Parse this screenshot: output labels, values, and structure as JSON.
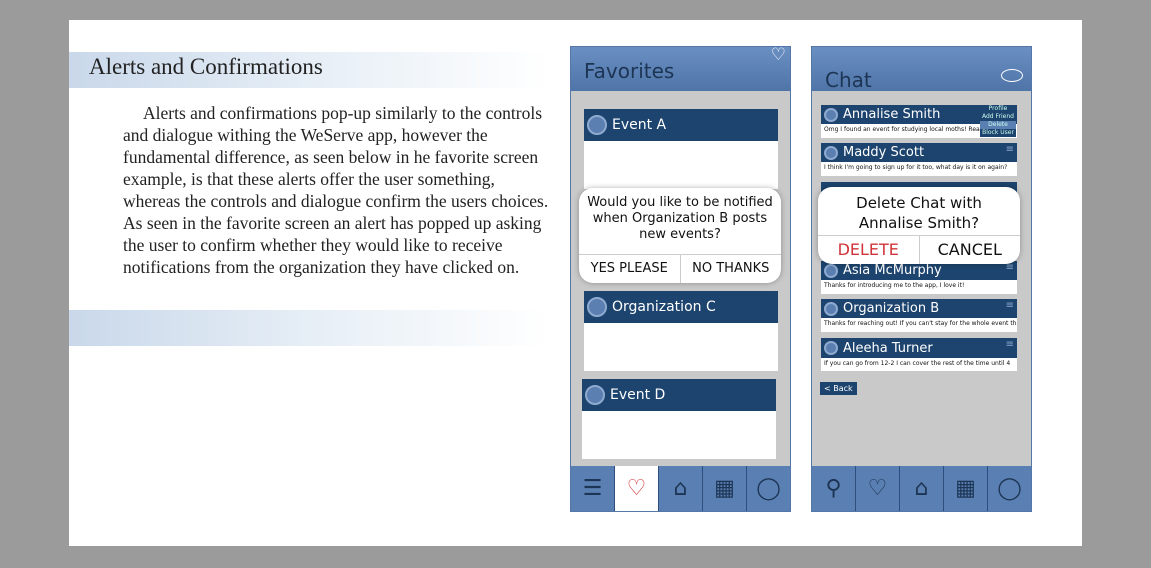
{
  "document": {
    "heading": "Alerts and Confirmations",
    "paragraph": "Alerts and confirmations pop-up similarly to the controls and dialogue withing the WeServe app, however the fundamental difference, as seen below in he favorite screen example, is that these alerts offer the user something, whereas the controls and dialogue confirm the users choices. As seen in the favorite screen an alert has popped up asking the user to confirm whether they would like to receive notifications from the organization they have clicked on."
  },
  "favorites": {
    "title": "Favorites",
    "cards": [
      "Event A",
      "Organization C",
      "Event D"
    ],
    "alert": {
      "message": "Would you like to be notified when Organization B posts new events?",
      "yes": "YES PLEASE",
      "no": "NO THANKS"
    }
  },
  "chat": {
    "title": "Chat",
    "chats": [
      {
        "name": "Annalise Smith",
        "message": "Omg I found an event for studying local moths! Reali..."
      },
      {
        "name": "Maddy Scott",
        "message": "I think I'm going to sign up for it too, what day is it on again?"
      },
      {
        "name": "Asia McMurphy",
        "message": "Thanks for introducing me to the app, I love it!"
      },
      {
        "name": "Organization B",
        "message": "Thanks for reaching out! If you can't stay for the whole event tha..."
      },
      {
        "name": "Aleeha Turner",
        "message": "If you can go from 12-2 I can cover the rest of the time until 4"
      }
    ],
    "menu": [
      "Profile",
      "Add Friend",
      "Delete",
      "Block User"
    ],
    "dialog": {
      "message": "Delete Chat with Annalise Smith?",
      "delete": "DELETE",
      "cancel": "CANCEL"
    },
    "back": "Back"
  },
  "colors": {
    "header": "#5b80b5",
    "card_header": "#1d446e",
    "delete": "#d0343a"
  }
}
